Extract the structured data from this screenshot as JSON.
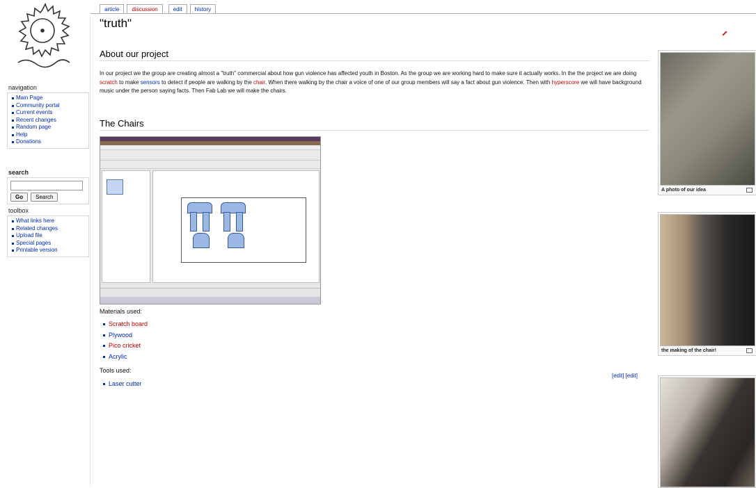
{
  "tabs": [
    {
      "label": "article"
    },
    {
      "label": "discussion"
    },
    {
      "label": "edit"
    },
    {
      "label": "history"
    }
  ],
  "page_title": "\"truth\"",
  "sidebar": {
    "navigation": {
      "heading": "navigation",
      "items": [
        "Main Page",
        "Community portal",
        "Current events",
        "Recent changes",
        "Random page",
        "Help",
        "Donations"
      ]
    },
    "search": {
      "heading": "search",
      "placeholder": "",
      "go_label": "Go",
      "search_label": "Search"
    },
    "toolbox": {
      "heading": "toolbox",
      "items": [
        "What links here",
        "Related changes",
        "Upload file",
        "Special pages",
        "Printable version"
      ]
    }
  },
  "section1": {
    "heading": "About our project",
    "p1": "In our project we the group are creating almost a \"truth\" commercial about how gun violence has affected youth in Boston. As the group we are working hard to make sure it actually works. In the the project we are doing ",
    "link_scratch": "scratch",
    "p2": " to make ",
    "link_sensors": "sensors",
    "p3": " to detect if people are walking by the ",
    "link_chair": "chair",
    "p4": ". When there walking by the chair a voice of one of our group members will say a fact about gun violence. Then with ",
    "link_hyperscore": "hyperscore",
    "p5": " we will have background music under the person saying facts. Then Fab Lab we will make the chairs."
  },
  "section2": {
    "heading": "The Chairs"
  },
  "materials": {
    "label": "Materials used:",
    "items": [
      "Scratch board",
      "Plywood",
      "Pico cricket",
      "Acrylic"
    ]
  },
  "tools": {
    "label": "Tools used:",
    "items": [
      "Laser cutter"
    ]
  },
  "edit_links": "[edit] [edit]",
  "thumbnails": [
    {
      "caption": "A photo of our idea"
    },
    {
      "caption": "the making of the chair!"
    },
    {
      "caption": ""
    }
  ],
  "colors": {
    "link_blue": "#002bb8",
    "link_red": "#ba0000"
  }
}
